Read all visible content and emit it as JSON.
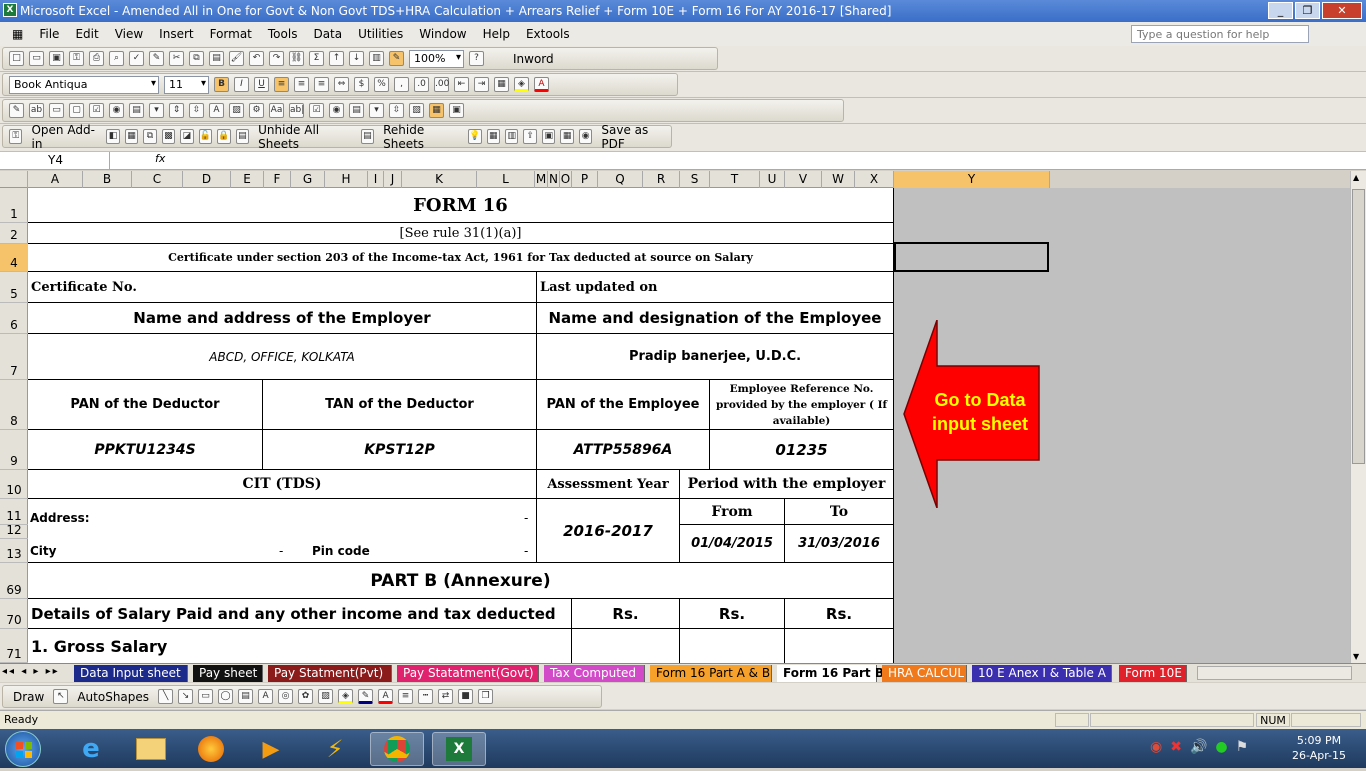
{
  "window": {
    "title": "Microsoft Excel - Amended All in One for Govt & Non Govt TDS+HRA Calculation + Arrears Relief + Form 10E + Form 16 For AY 2016-17  [Shared]"
  },
  "menu": {
    "items": [
      "File",
      "Edit",
      "View",
      "Insert",
      "Format",
      "Tools",
      "Data",
      "Utilities",
      "Window",
      "Help",
      "Extools"
    ],
    "help_placeholder": "Type a question for help"
  },
  "toolbar": {
    "zoom": "100%",
    "inword": "Inword",
    "font": "Book Antiqua",
    "size": "11",
    "open_addin": "Open Add-in",
    "unhide": "Unhide All Sheets",
    "rehide": "Rehide Sheets",
    "save_pdf": "Save as PDF"
  },
  "formula_bar": {
    "name_box": "Y4",
    "fx": "fx",
    "content": ""
  },
  "columns": [
    "A",
    "B",
    "C",
    "D",
    "E",
    "F",
    "G",
    "H",
    "I",
    "J",
    "K",
    "L",
    "M",
    "N",
    "O",
    "P",
    "Q",
    "R",
    "S",
    "T",
    "U",
    "V",
    "W",
    "X",
    "Y"
  ],
  "rows": [
    "1",
    "2",
    "4",
    "5",
    "6",
    "7",
    "8",
    "9",
    "10",
    "11",
    "12",
    "13",
    "69",
    "70",
    "71"
  ],
  "form": {
    "title": "FORM 16",
    "rule": "[See rule 31(1)(a)]",
    "certificate_caption": "Certificate under section 203 of the Income-tax Act, 1961 for Tax deducted at source on Salary",
    "cert_no_label": "Certificate No.",
    "last_updated_label": "Last updated on",
    "employer_label": "Name and address of the Employer",
    "employee_label": "Name and designation of the Employee",
    "employer_value": "ABCD, OFFICE, KOLKATA",
    "employee_value": "Pradip banerjee, U.D.C.",
    "pan_deductor_label": "PAN of the Deductor",
    "tan_deductor_label": "TAN of the Deductor",
    "pan_employee_label": "PAN of the Employee",
    "emp_ref_label": "Employee Reference No. provided by the employer ( If available)",
    "pan_deductor": "PPKTU1234S",
    "tan_deductor": "KPST12P",
    "pan_employee": "ATTP55896A",
    "emp_ref": "01235",
    "cit_label": "CIT (TDS)",
    "assessment_label": "Assessment Year",
    "period_label": "Period with the employer",
    "address_label": "Address:",
    "dash1": "-",
    "city_label": "City",
    "dash2": "-",
    "pincode_label": "Pin code",
    "dash3": "-",
    "assessment_year": "2016-2017",
    "from_label": "From",
    "to_label": "To",
    "from_value": "01/04/2015",
    "to_value": "31/03/2016",
    "part_b": "PART B (Annexure)",
    "details_label": "Details of Salary Paid and any other income and tax deducted",
    "rs1": "Rs.",
    "rs2": "Rs.",
    "rs3": "Rs.",
    "gross_salary": "1.  Gross Salary"
  },
  "shape": {
    "text": "Go to Data input sheet",
    "fill": "#ff0000",
    "text_color": "#ffff00"
  },
  "tabs": [
    {
      "label": "Data Input sheet",
      "bg": "#1c2a8c",
      "fg": "#ffffff"
    },
    {
      "label": "Pay sheet",
      "bg": "#111111",
      "fg": "#ffffff"
    },
    {
      "label": "Pay Statment(Pvt)",
      "bg": "#8b1a1a",
      "fg": "#ffffff"
    },
    {
      "label": "Pay Statatment(Govt)",
      "bg": "#e0216e",
      "fg": "#ffffff"
    },
    {
      "label": "Tax Computed",
      "bg": "#d24ac8",
      "fg": "#ffffff"
    },
    {
      "label": "Form 16 Part A & B",
      "bg": "#f7a12b",
      "fg": "#000000"
    },
    {
      "label": "Form 16 Part B",
      "bg": "#ffffff",
      "fg": "#000000"
    },
    {
      "label": "HRA CALCUL",
      "bg": "#f07a1b",
      "fg": "#ffffff"
    },
    {
      "label": "10 E Anex I & Table A",
      "bg": "#3b2fb0",
      "fg": "#ffffff"
    },
    {
      "label": "Form 10E",
      "bg": "#e0212b",
      "fg": "#ffffff"
    }
  ],
  "drawbar": {
    "draw": "Draw",
    "autoshapes": "AutoShapes"
  },
  "status": {
    "left": "Ready",
    "num": "NUM"
  },
  "taskbar": {
    "time": "5:09 PM",
    "date": "26-Apr-15"
  }
}
